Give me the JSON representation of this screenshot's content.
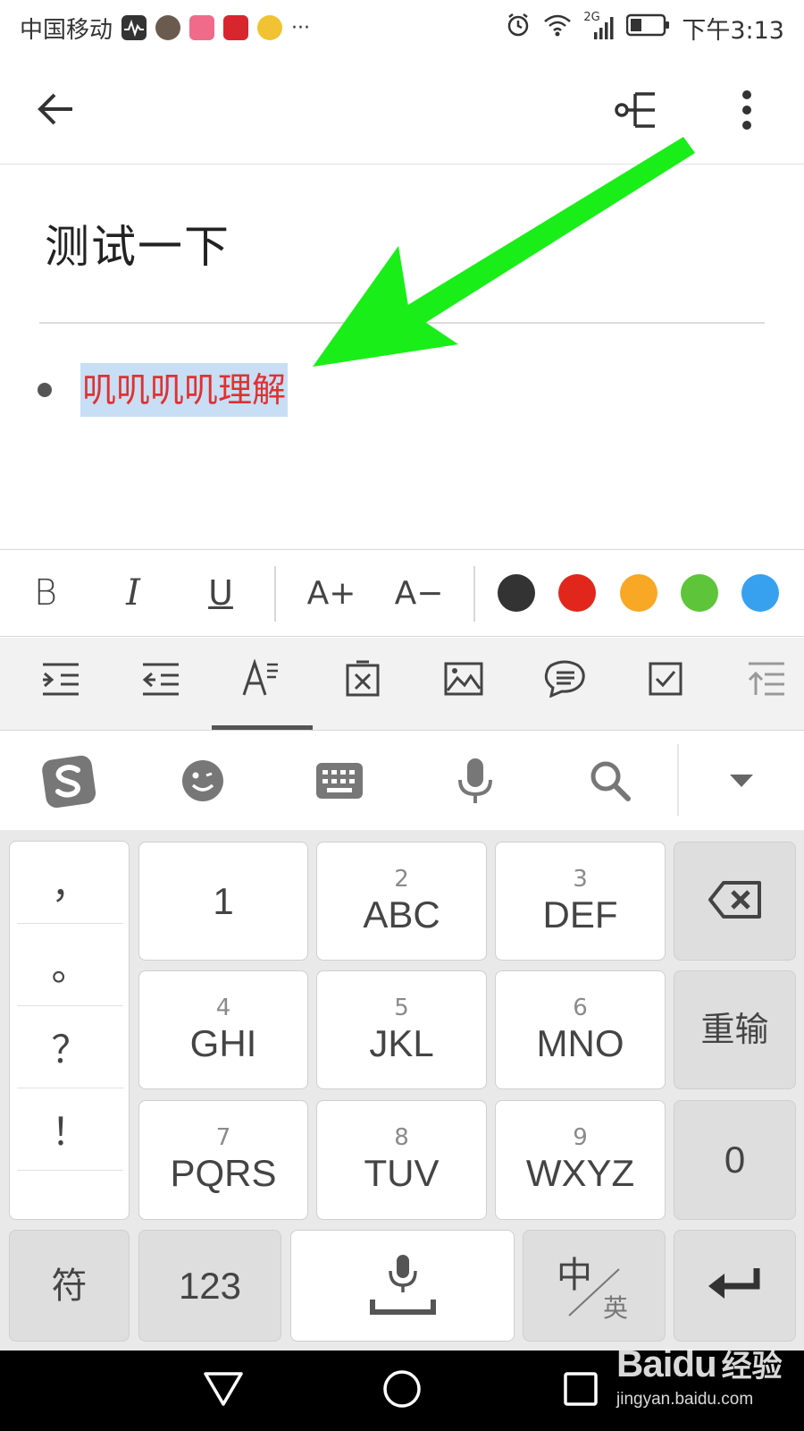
{
  "status_bar": {
    "carrier": "中国移动",
    "network": "2G",
    "time": "下午3:13",
    "more_indicator": "···",
    "notification_icons": [
      "activity-icon",
      "avatar-app-icon",
      "face-app-icon",
      "netease-app-icon",
      "weibo-icon"
    ],
    "right_icons": [
      "alarm-icon",
      "wifi-icon",
      "signal-icon",
      "battery-icon"
    ]
  },
  "app_bar": {
    "back_icon": "arrow-left-icon",
    "mindmap_icon": "mind-map-icon",
    "more_icon": "more-vertical-icon"
  },
  "note": {
    "title": "测试一下",
    "bullet_text": "叽叽叽叽理解",
    "bullet_text_color": "#e03131",
    "selection_color": "#c7def5"
  },
  "annotation": {
    "arrow_color": "#19ee19"
  },
  "format_toolbar": {
    "bold": "B",
    "italic": "I",
    "underline": "U",
    "font_increase": "A+",
    "font_decrease": "A−",
    "colors": [
      "#333333",
      "#e1261c",
      "#f9a825",
      "#5ec43a",
      "#37a1f0"
    ]
  },
  "tools_toolbar": {
    "items": [
      "indent-icon",
      "outdent-icon",
      "text-style-icon",
      "delete-box-icon",
      "image-icon",
      "comment-list-icon",
      "checkbox-icon",
      "move-up-icon"
    ],
    "active": "text-style-icon"
  },
  "ime_bar": {
    "items": [
      "sogou-logo-icon",
      "emoji-icon",
      "keyboard-icon",
      "microphone-icon",
      "search-icon",
      "collapse-icon"
    ]
  },
  "keyboard": {
    "punctuation": [
      "，",
      "。",
      "？",
      "！"
    ],
    "keys": [
      {
        "num": "",
        "label": "1"
      },
      {
        "num": "2",
        "label": "ABC"
      },
      {
        "num": "3",
        "label": "DEF"
      },
      {
        "num": "4",
        "label": "GHI"
      },
      {
        "num": "5",
        "label": "JKL"
      },
      {
        "num": "6",
        "label": "MNO"
      },
      {
        "num": "7",
        "label": "PQRS"
      },
      {
        "num": "8",
        "label": "TUV"
      },
      {
        "num": "9",
        "label": "WXYZ"
      }
    ],
    "backspace_icon": "backspace-icon",
    "reset_label": "重输",
    "zero_label": "0",
    "symbol_label": "符",
    "numeric_label": "123",
    "space_icon": "space-mic-icon",
    "lang_main": "中",
    "lang_sub": "英",
    "enter_icon": "enter-icon"
  },
  "nav_bar": {
    "back_icon": "nav-back-icon",
    "home_icon": "nav-home-icon",
    "recents_icon": "nav-recents-icon"
  },
  "watermark": {
    "brand": "Baidu",
    "sub": "经验",
    "url": "jingyan.baidu.com"
  }
}
